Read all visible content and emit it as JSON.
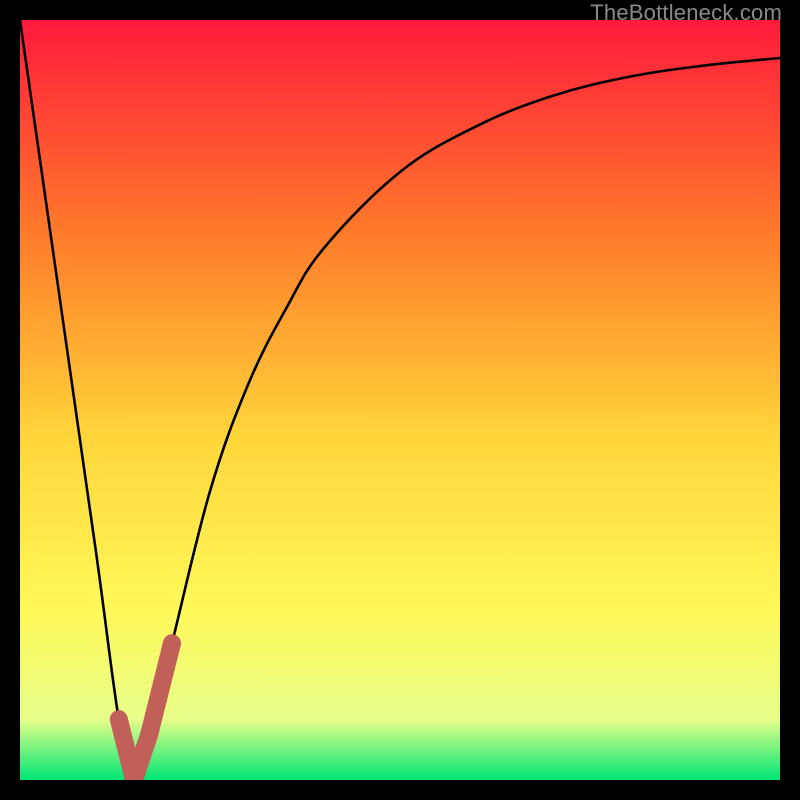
{
  "watermark": "TheBottleneck.com",
  "colors": {
    "bg": "#000000",
    "gradient_top": "#ff1a3c",
    "gradient_mid1": "#ff7a2a",
    "gradient_mid2": "#ffd63a",
    "gradient_mid3": "#fff95a",
    "gradient_mid4": "#e8ff8a",
    "gradient_bottom": "#00e676",
    "curve": "#000000",
    "highlight": "#c06058"
  },
  "chart_data": {
    "type": "line",
    "title": "",
    "xlabel": "",
    "ylabel": "",
    "xlim": [
      0,
      100
    ],
    "ylim": [
      0,
      100
    ],
    "series": [
      {
        "name": "bottleneck-curve",
        "x": [
          0,
          5,
          10,
          13,
          15,
          17,
          20,
          25,
          30,
          35,
          40,
          50,
          60,
          70,
          80,
          90,
          100
        ],
        "values": [
          100,
          65,
          30,
          8,
          0,
          6,
          18,
          38,
          52,
          62,
          70,
          80,
          86,
          90,
          92.5,
          94,
          95
        ]
      },
      {
        "name": "highlight-segment",
        "x": [
          13,
          15,
          17,
          19,
          20
        ],
        "values": [
          8,
          0,
          6,
          14,
          18
        ]
      }
    ],
    "optimum_x": 15,
    "optimum_y": 0
  }
}
